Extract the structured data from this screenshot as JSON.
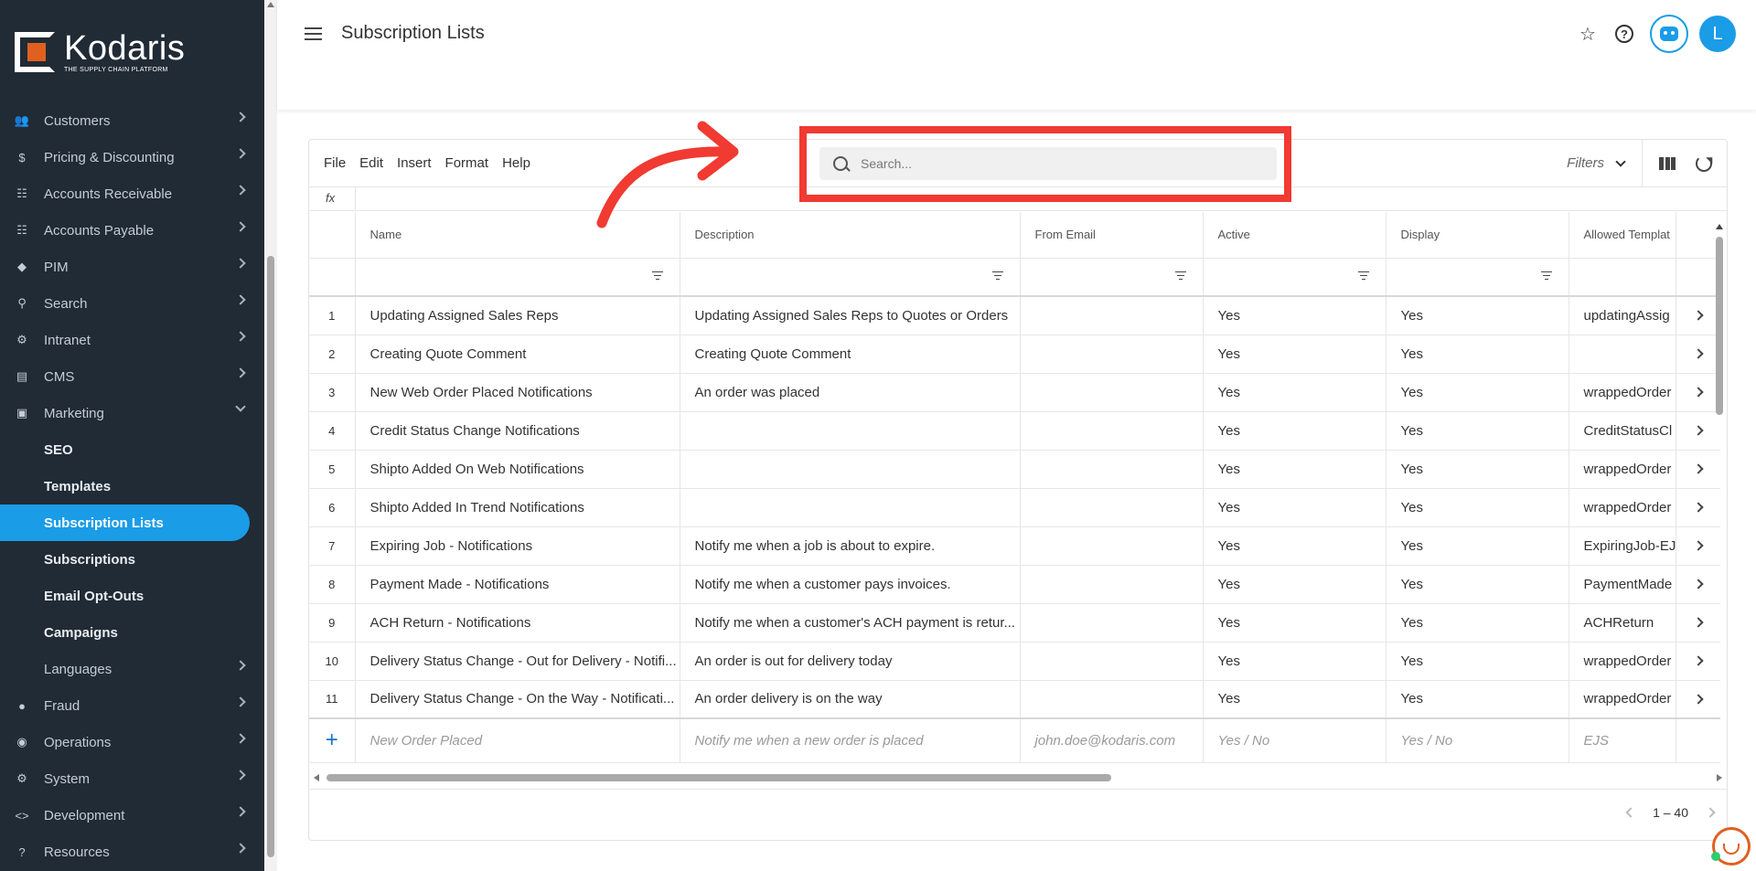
{
  "brand": {
    "name": "Kodaris",
    "tagline": "THE SUPPLY CHAIN PLATFORM",
    "accent": "#1a9ce7",
    "logo_color": "#e0611f"
  },
  "sidebar": {
    "items": [
      {
        "label": "Customers",
        "icon": "users-icon"
      },
      {
        "label": "Pricing & Discounting",
        "icon": "dollar-icon"
      },
      {
        "label": "Accounts Receivable",
        "icon": "bank-icon"
      },
      {
        "label": "Accounts Payable",
        "icon": "bank-icon"
      },
      {
        "label": "PIM",
        "icon": "tag-icon"
      },
      {
        "label": "Search",
        "icon": "search-icon"
      },
      {
        "label": "Intranet",
        "icon": "globe-icon"
      },
      {
        "label": "CMS",
        "icon": "card-icon"
      },
      {
        "label": "Marketing",
        "icon": "contact-card-icon",
        "expanded": true
      }
    ],
    "marketing_sub": [
      {
        "label": "SEO"
      },
      {
        "label": "Templates"
      },
      {
        "label": "Subscription Lists",
        "active": true
      },
      {
        "label": "Subscriptions"
      },
      {
        "label": "Email Opt-Outs"
      },
      {
        "label": "Campaigns"
      }
    ],
    "items_after": [
      {
        "label": "Languages",
        "icon": "translate-icon"
      },
      {
        "label": "Fraud",
        "icon": "alert-icon"
      },
      {
        "label": "Operations",
        "icon": "palette-icon"
      },
      {
        "label": "System",
        "icon": "gear-icon"
      },
      {
        "label": "Development",
        "icon": "code-icon"
      },
      {
        "label": "Resources",
        "icon": "help-icon"
      }
    ]
  },
  "header": {
    "title": "Subscription Lists",
    "avatar_initial": "L"
  },
  "toolbar": {
    "menu": [
      "File",
      "Edit",
      "Insert",
      "Format",
      "Help"
    ],
    "search_placeholder": "Search...",
    "filters_label": "Filters",
    "fx_label": "fx"
  },
  "table": {
    "columns": [
      "Name",
      "Description",
      "From Email",
      "Active",
      "Display",
      "Allowed Templat"
    ],
    "rows": [
      {
        "n": "1",
        "name": "Updating Assigned Sales Reps",
        "desc": "Updating Assigned Sales Reps to Quotes or Orders",
        "email": "",
        "active": "Yes",
        "display": "Yes",
        "tmpl": "updatingAssig"
      },
      {
        "n": "2",
        "name": "Creating Quote Comment",
        "desc": "Creating Quote Comment",
        "email": "",
        "active": "Yes",
        "display": "Yes",
        "tmpl": ""
      },
      {
        "n": "3",
        "name": "New Web Order Placed Notifications",
        "desc": "An order was placed",
        "email": "",
        "active": "Yes",
        "display": "Yes",
        "tmpl": "wrappedOrder"
      },
      {
        "n": "4",
        "name": "Credit Status Change Notifications",
        "desc": "",
        "email": "",
        "active": "Yes",
        "display": "Yes",
        "tmpl": "CreditStatusCl"
      },
      {
        "n": "5",
        "name": "Shipto Added On Web Notifications",
        "desc": "",
        "email": "",
        "active": "Yes",
        "display": "Yes",
        "tmpl": "wrappedOrder"
      },
      {
        "n": "6",
        "name": "Shipto Added In Trend Notifications",
        "desc": "",
        "email": "",
        "active": "Yes",
        "display": "Yes",
        "tmpl": "wrappedOrder"
      },
      {
        "n": "7",
        "name": "Expiring Job - Notifications",
        "desc": "Notify me when a job is about to expire.",
        "email": "",
        "active": "Yes",
        "display": "Yes",
        "tmpl": "ExpiringJob-EJ"
      },
      {
        "n": "8",
        "name": "Payment Made - Notifications",
        "desc": "Notify me when a customer pays invoices.",
        "email": "",
        "active": "Yes",
        "display": "Yes",
        "tmpl": "PaymentMade"
      },
      {
        "n": "9",
        "name": "ACH Return - Notifications",
        "desc": "Notify me when a customer's ACH payment is retur...",
        "email": "",
        "active": "Yes",
        "display": "Yes",
        "tmpl": "ACHReturn"
      },
      {
        "n": "10",
        "name": "Delivery Status Change - Out for Delivery - Notifi...",
        "desc": "An order is out for delivery today",
        "email": "",
        "active": "Yes",
        "display": "Yes",
        "tmpl": "wrappedOrder"
      },
      {
        "n": "11",
        "name": "Delivery Status Change - On the Way - Notificati...",
        "desc": "An order delivery is on the way",
        "email": "",
        "active": "Yes",
        "display": "Yes",
        "tmpl": "wrappedOrder"
      }
    ],
    "new_row": {
      "name": "New Order Placed",
      "desc": "Notify me when a new order is placed",
      "email": "john.doe@kodaris.com",
      "active": "Yes / No",
      "display": "Yes / No",
      "tmpl": "EJS"
    }
  },
  "pager": {
    "range": "1 – 40"
  },
  "annotation": {
    "color": "#f03a32"
  }
}
